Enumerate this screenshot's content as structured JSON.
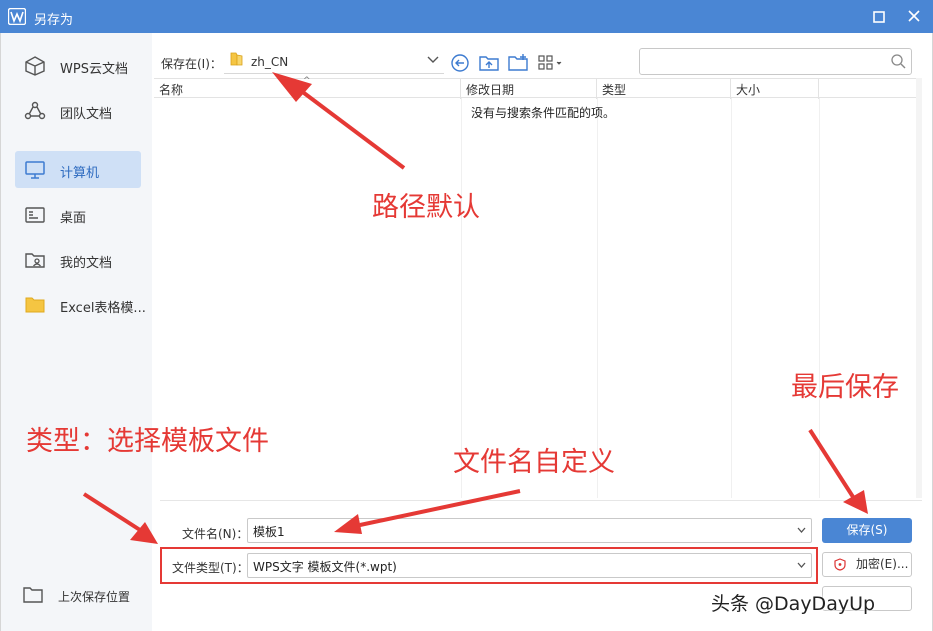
{
  "window": {
    "title": "另存为",
    "accent_color": "#4a86d4",
    "logo_icon": "wps-logo-icon",
    "maximize_icon": "maximize-icon",
    "close_icon": "close-icon"
  },
  "sidebar": {
    "items": [
      {
        "label": "WPS云文档",
        "icon": "cloud-cube-icon",
        "active": false
      },
      {
        "label": "团队文档",
        "icon": "team-icon",
        "active": false
      },
      {
        "label": "计算机",
        "icon": "computer-icon",
        "active": true
      },
      {
        "label": "桌面",
        "icon": "desktop-icon",
        "active": false
      },
      {
        "label": "我的文档",
        "icon": "my-documents-icon",
        "active": false
      },
      {
        "label": "Excel表格模...",
        "icon": "folder-icon",
        "active": false
      }
    ],
    "bottom": {
      "label": "上次保存位置",
      "icon": "folder-outline-icon"
    }
  },
  "toolbar": {
    "save_in_label": "保存在(I)：",
    "path": "zh_CN",
    "buttons": [
      "back-icon",
      "up-folder-icon",
      "new-folder-icon",
      "view-mode-icon"
    ],
    "search_placeholder": ""
  },
  "list": {
    "columns": [
      "名称",
      "修改日期",
      "类型",
      "大小"
    ],
    "empty_message": "没有与搜索条件匹配的项。"
  },
  "form": {
    "filename_label": "文件名(N)：",
    "filename_value": "模板1",
    "filetype_label": "文件类型(T)：",
    "filetype_value": "WPS文字 模板文件(*.wpt)",
    "save_button": "保存(S)",
    "encrypt_button": "加密(E)..."
  },
  "annotations": {
    "path_default": "路径默认",
    "final_save": "最后保存",
    "choose_type": "类型：选择模板文件",
    "custom_name": "文件名自定义",
    "color": "#e53935"
  },
  "watermark": "头条 @DayDayUp"
}
